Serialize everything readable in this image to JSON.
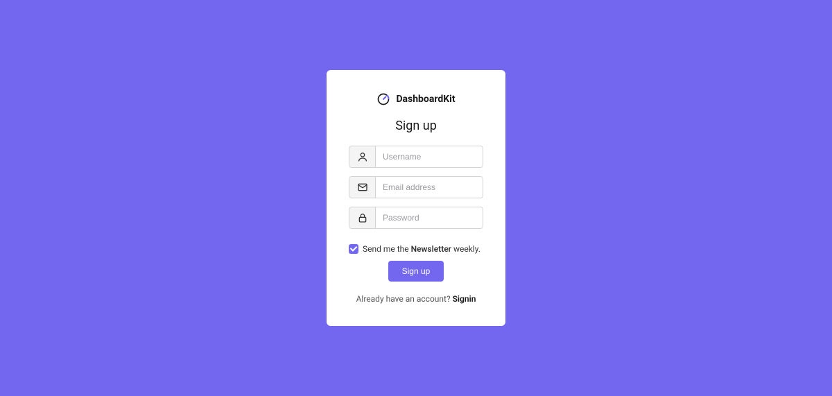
{
  "brand": {
    "name": "DashboardKit"
  },
  "card": {
    "title": "Sign up"
  },
  "fields": {
    "username": {
      "placeholder": "Username",
      "value": ""
    },
    "email": {
      "placeholder": "Email address",
      "value": ""
    },
    "password": {
      "placeholder": "Password",
      "value": ""
    }
  },
  "checkbox": {
    "prefix": "Send me the ",
    "bold": "Newsletter",
    "suffix": " weekly.",
    "checked": true
  },
  "button": {
    "signup": "Sign up"
  },
  "footer": {
    "prompt": "Already have an account? ",
    "link": "Signin"
  }
}
